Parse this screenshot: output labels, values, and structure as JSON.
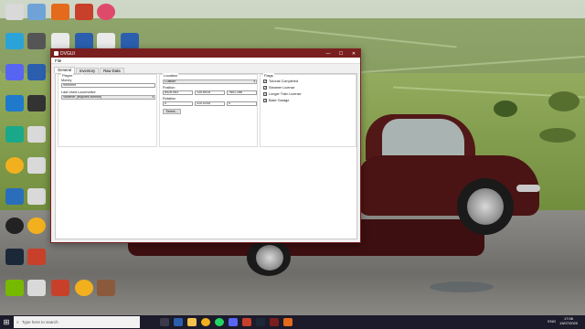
{
  "window": {
    "title": "DVGUI",
    "menu": [
      "File"
    ],
    "tabs": [
      "General",
      "Inventory",
      "Raw Data"
    ]
  },
  "player": {
    "group_title": "Player",
    "money_label": "Money",
    "money_value": "9999999",
    "last_loco_label": "Last Used Locomotive",
    "last_loco_value": "Steamer (requires license)"
  },
  "location": {
    "group_title": "Location",
    "preset_value": "Custom",
    "position_label": "Position",
    "position": [
      "8428.063",
      "130.6915",
      "7801.286"
    ],
    "rotation_label": "Rotation",
    "rotation": [
      "0",
      "310.0245",
      "0"
    ],
    "select_button": "Select..."
  },
  "flags": {
    "group_title": "Flags",
    "items": [
      {
        "label": "Tutorial Completed",
        "checked": true
      },
      {
        "label": "Steamer License",
        "checked": true
      },
      {
        "label": "Longer Train License",
        "checked": true
      },
      {
        "label": "Bake Garage",
        "checked": true
      }
    ]
  },
  "taskbar": {
    "search_placeholder": "Type here to search",
    "time": "17:06",
    "date": "13/07/2020",
    "lang": "ENG"
  },
  "icons": {
    "check_mark": "✓",
    "windows_logo": "⊞",
    "search_icon": "⌕",
    "minimize": "—",
    "maximize": "☐",
    "close": "✕",
    "combo_arrow": "▾"
  },
  "colors": {
    "title_bar": "#7a1f1f",
    "taskbar": "#1b1b2b"
  }
}
